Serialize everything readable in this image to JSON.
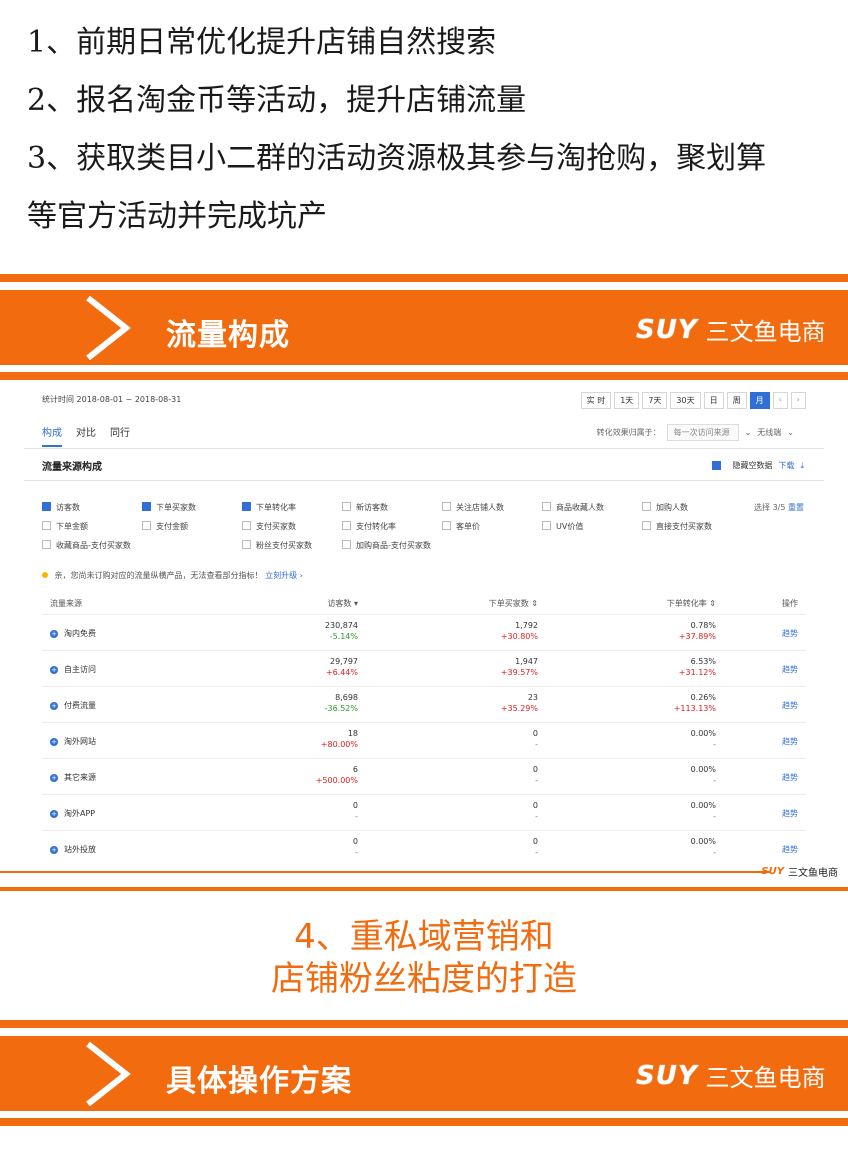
{
  "intro": {
    "line1": "1、前期日常优化提升店铺自然搜索",
    "line2": "2、报名淘金币等活动，提升店铺流量",
    "line3": "3、获取类目小二群的活动资源极其参与淘抢购，聚划算",
    "line4": "等官方活动并完成坑产"
  },
  "banner1": {
    "title": "流量构成",
    "logo_mark": "SUY",
    "logo_text": "三文鱼电商"
  },
  "banner2": {
    "title": "具体操作方案",
    "logo_mark": "SUY",
    "logo_text": "三文鱼电商"
  },
  "screenshot": {
    "stat_time": "统计时间 2018-08-01 ~ 2018-08-31",
    "time_buttons": [
      "实 时",
      "1天",
      "7天",
      "30天",
      "日",
      "周",
      "月",
      "‹",
      "›"
    ],
    "active_time": "月",
    "tabs": [
      "构成",
      "对比",
      "同行"
    ],
    "convert_label": "转化效果归属于：",
    "convert_select": "每一次访问来源",
    "wireless": "无线端",
    "section_title": "流量来源构成",
    "hide_data": "隐藏空数据",
    "download": "下载",
    "metrics": [
      {
        "label": "访客数",
        "checked": true
      },
      {
        "label": "下单买家数",
        "checked": true
      },
      {
        "label": "下单转化率",
        "checked": true
      },
      {
        "label": "新访客数",
        "checked": false
      },
      {
        "label": "关注店铺人数",
        "checked": false
      },
      {
        "label": "商品收藏人数",
        "checked": false
      },
      {
        "label": "加购人数",
        "checked": false
      },
      {
        "label": "下单金额",
        "checked": false
      },
      {
        "label": "支付金额",
        "checked": false
      },
      {
        "label": "支付买家数",
        "checked": false
      },
      {
        "label": "支付转化率",
        "checked": false
      },
      {
        "label": "客单价",
        "checked": false
      },
      {
        "label": "UV价值",
        "checked": false
      },
      {
        "label": "直接支付买家数",
        "checked": false
      },
      {
        "label": "收藏商品-支付买家数",
        "checked": false
      },
      {
        "label": "",
        "checked": null
      },
      {
        "label": "粉丝支付买家数",
        "checked": false
      },
      {
        "label": "加购商品-支付买家数",
        "checked": false
      }
    ],
    "choose_text": "选择 3/5",
    "reset": "重置",
    "notice": "亲，您尚未订购对应的流量纵横产品，无法查看部分指标！",
    "notice_link": "立刻升级 ›",
    "columns": {
      "source": "流量来源",
      "visitors": "访客数 ▾",
      "buyers": "下单买家数 ⇕",
      "rate": "下单转化率 ⇕",
      "action": "操作"
    },
    "rows": [
      {
        "source": "淘内免费",
        "v": "230,874",
        "vd": "-5.14%",
        "vt": "down",
        "b": "1,792",
        "bd": "+30.80%",
        "bt": "up",
        "r": "0.78%",
        "rd": "+37.89%",
        "rt": "up",
        "act": "趋势"
      },
      {
        "source": "自主访问",
        "v": "29,797",
        "vd": "+6.44%",
        "vt": "up",
        "b": "1,947",
        "bd": "+39.57%",
        "bt": "up",
        "r": "6.53%",
        "rd": "+31.12%",
        "rt": "up",
        "act": "趋势"
      },
      {
        "source": "付费流量",
        "v": "8,698",
        "vd": "-36.52%",
        "vt": "down",
        "b": "23",
        "bd": "+35.29%",
        "bt": "up",
        "r": "0.26%",
        "rd": "+113.13%",
        "rt": "up",
        "act": "趋势"
      },
      {
        "source": "淘外网站",
        "v": "18",
        "vd": "+80.00%",
        "vt": "up",
        "b": "0",
        "bd": "-",
        "bt": "flat",
        "r": "0.00%",
        "rd": "-",
        "rt": "flat",
        "act": "趋势"
      },
      {
        "source": "其它来源",
        "v": "6",
        "vd": "+500.00%",
        "vt": "up",
        "b": "0",
        "bd": "-",
        "bt": "flat",
        "r": "0.00%",
        "rd": "-",
        "rt": "flat",
        "act": "趋势"
      },
      {
        "source": "淘外APP",
        "v": "0",
        "vd": "-",
        "vt": "flat",
        "b": "0",
        "bd": "-",
        "bt": "flat",
        "r": "0.00%",
        "rd": "-",
        "rt": "flat",
        "act": "趋势"
      },
      {
        "source": "站外投放",
        "v": "0",
        "vd": "-",
        "vt": "flat",
        "b": "0",
        "bd": "-",
        "bt": "flat",
        "r": "0.00%",
        "rd": "-",
        "rt": "flat",
        "act": "趋势"
      }
    ],
    "footer_logo_mark": "SUY",
    "footer_logo_text": "三文鱼电商"
  },
  "heading4": {
    "line1": "4、重私域营销和",
    "line2": "店铺粉丝粘度的打造"
  },
  "colors": {
    "orange": "#f26b0f",
    "blue": "#2f6fd6",
    "up": "#e02020",
    "down": "#2a9d2a"
  }
}
